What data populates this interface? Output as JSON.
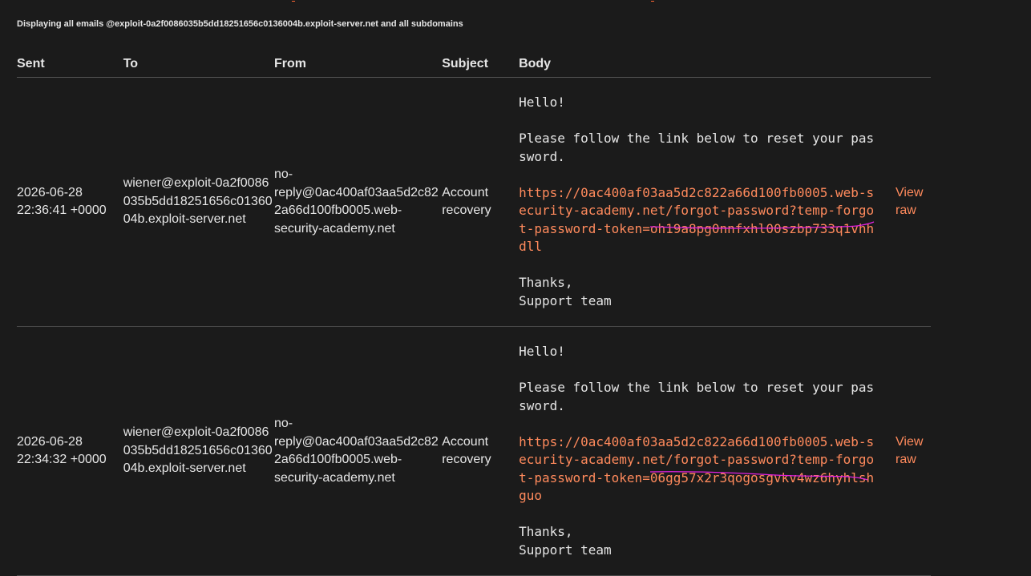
{
  "notice": "Displaying all emails @exploit-0a2f0086035b5dd18251656c0136004b.exploit-server.net and all subdomains",
  "columns": [
    "Sent",
    "To",
    "From",
    "Subject",
    "Body"
  ],
  "emails": [
    {
      "sent": "2026-06-28 22:36:41 +0000",
      "to": "wiener@exploit-0a2f0086035b5dd18251656c0136004b.exploit-server.net",
      "from": "no-reply@0ac400af03aa5d2c822a66d100fb0005.web-security-academy.net",
      "subject": "Account recovery",
      "greeting": "Hello!",
      "instruction": "Please follow the link below to reset your password.",
      "link": "https://0ac400af03aa5d2c822a66d100fb0005.web-security-academy.net/forgot-password?temp-forgot-password-token=oh19a8pg0nnfxhl00szbp733q1vhhdll",
      "thanks": "Thanks,",
      "signature": "Support team",
      "view_raw": "View raw"
    },
    {
      "sent": "2026-06-28 22:34:32 +0000",
      "to": "wiener@exploit-0a2f0086035b5dd18251656c0136004b.exploit-server.net",
      "from": "no-reply@0ac400af03aa5d2c822a66d100fb0005.web-security-academy.net",
      "subject": "Account recovery",
      "greeting": "Hello!",
      "instruction": "Please follow the link below to reset your password.",
      "link": "https://0ac400af03aa5d2c822a66d100fb0005.web-security-academy.net/forgot-password?temp-forgot-password-token=06gg57x2r3qogosgvkv4wz6hyhlshguo",
      "thanks": "Thanks,",
      "signature": "Support team",
      "view_raw": "View raw"
    }
  ],
  "colors": {
    "background": "#1b1b1b",
    "text": "#e6e6e6",
    "link": "#ff8a5c",
    "annotation": "#e020e0"
  }
}
